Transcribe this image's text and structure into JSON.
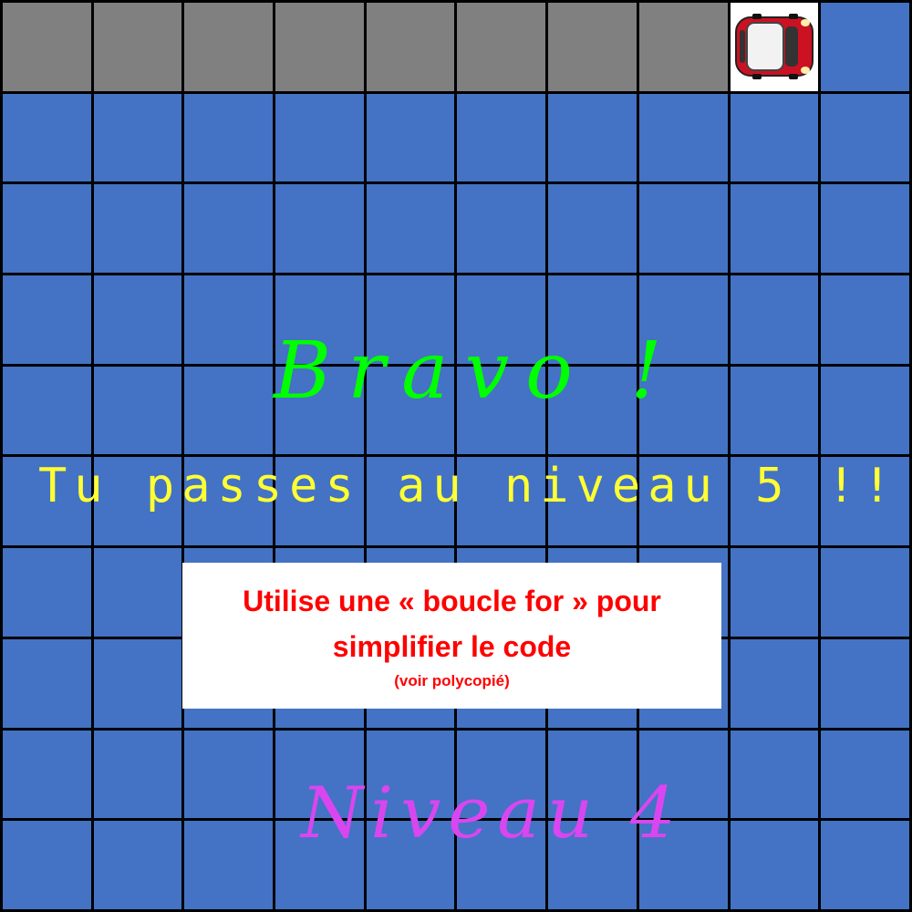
{
  "board": {
    "rows": 10,
    "cols": 10,
    "road_row": 0,
    "road_cols": [
      0,
      1,
      2,
      3,
      4,
      5,
      6,
      7
    ],
    "car_position": {
      "row": 0,
      "col": 8
    },
    "colors": {
      "water": "#4472C4",
      "road": "#808080",
      "car_cell": "#ffffff",
      "grid_line": "#000000"
    }
  },
  "car": {
    "icon": "red-car-icon",
    "color": "#cc1122"
  },
  "messages": {
    "bravo": "Bravo !",
    "level_up": "Tu passes au niveau 5 !!",
    "level": "Niveau 4"
  },
  "hint": {
    "line1": "Utilise une « boucle for » pour",
    "line2": "simplifier le code",
    "note": "(voir polycopié)"
  }
}
